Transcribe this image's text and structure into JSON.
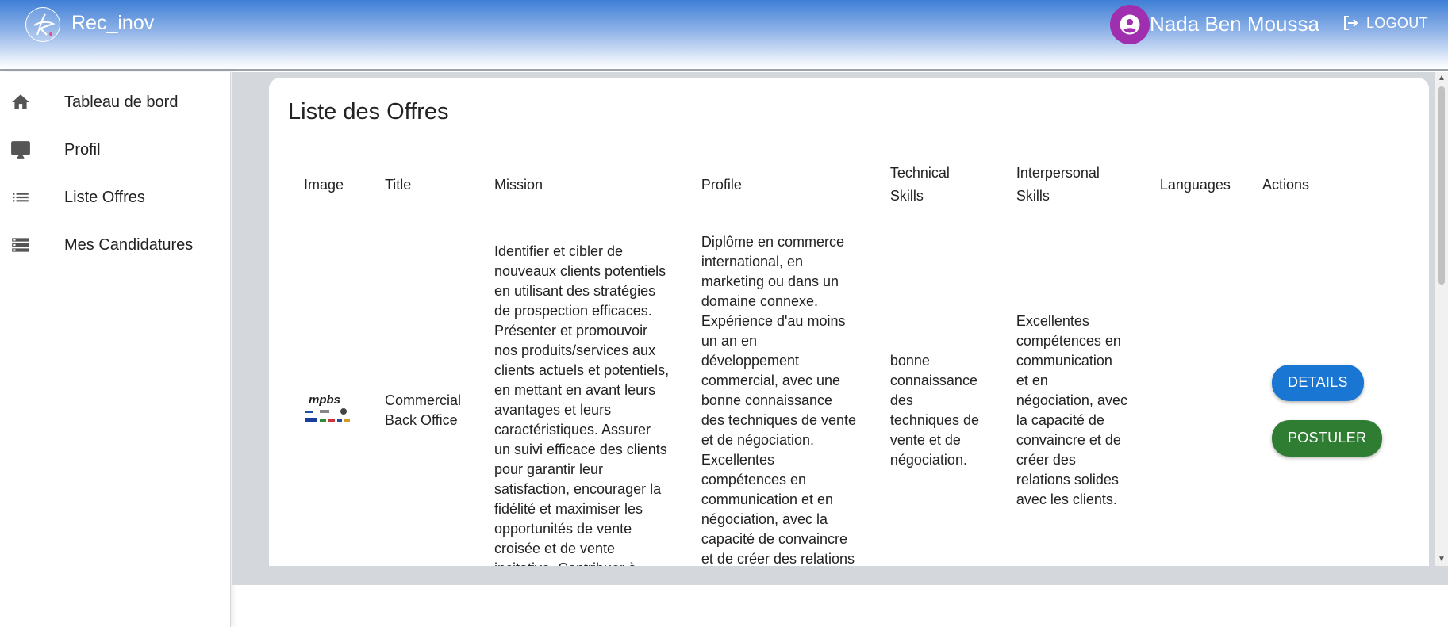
{
  "header": {
    "app_title": "Rec_inov",
    "user_name": "Nada Ben Moussa",
    "logout_label": "LOGOUT"
  },
  "sidebar": {
    "items": [
      {
        "label": "Tableau de bord",
        "icon": "home-icon"
      },
      {
        "label": "Profil",
        "icon": "monitor-icon"
      },
      {
        "label": "Liste Offres",
        "icon": "list-icon"
      },
      {
        "label": "Mes Candidatures",
        "icon": "storage-icon"
      }
    ]
  },
  "main": {
    "title": "Liste des Offres",
    "table": {
      "headers": [
        "Image",
        "Title",
        "Mission",
        "Profile",
        "Technical Skills",
        "Interpersonal Skills",
        "Languages",
        "Actions"
      ],
      "rows": [
        {
          "image_alt": "mpbs",
          "title": "Commercial Back Office",
          "mission": "Identifier et cibler de nouveaux clients potentiels en utilisant des stratégies de prospection efficaces. Présenter et promouvoir nos produits/services aux clients actuels et potentiels, en mettant en avant leurs avantages et leurs caractéristiques. Assurer un suivi efficace des clients pour garantir leur satisfaction, encourager la fidélité et maximiser les opportunités de vente croisée et de vente incitative. Contribuer à",
          "profile": "Diplôme en commerce international, en marketing ou dans un domaine connexe. Expérience d'au moins un an en développement commercial, avec une bonne connaissance des techniques de vente et de négociation. Excellentes compétences en communication et en négociation, avec la capacité de convaincre et de créer des relations solides avec les clients.",
          "technical_skills": "bonne connaissance des techniques de vente et de négociation.",
          "interpersonal_skills": "Excellentes compétences en communication et en négociation, avec la capacité de convaincre et de créer des relations solides avec les clients.",
          "languages": "",
          "details_label": "DETAILS",
          "postuler_label": "POSTULER"
        }
      ]
    }
  },
  "colors": {
    "header_top": "#3f7fd6",
    "avatar": "#a02fb0",
    "details_button": "#1976d2",
    "postuler_button": "#2e7d32",
    "main_background": "#d4d8dd"
  }
}
